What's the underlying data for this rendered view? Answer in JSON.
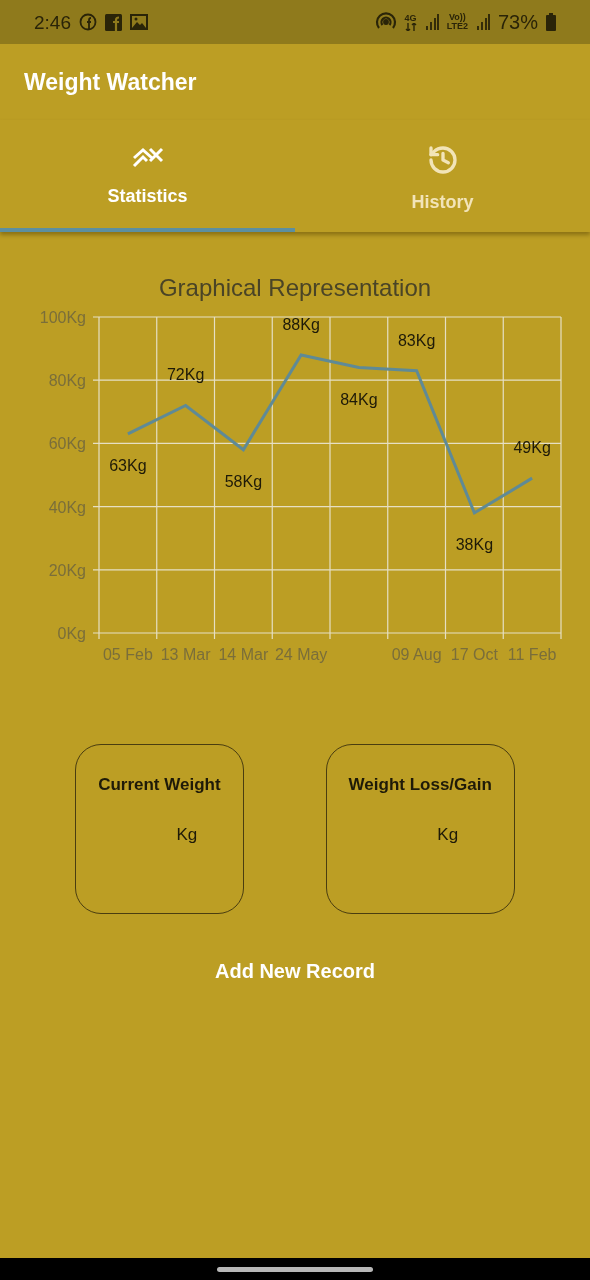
{
  "status_bar": {
    "time": "2:46",
    "network": "4G",
    "volte": "Vo))",
    "volte_sub": "LTE2",
    "battery": "73%"
  },
  "app_bar": {
    "title": "Weight Watcher"
  },
  "tabs": [
    {
      "label": "Statistics",
      "kind": "chart",
      "selected": true
    },
    {
      "label": "History",
      "kind": "history",
      "selected": false
    }
  ],
  "chart": {
    "chart_data": {
      "type": "line",
      "title": "Graphical Representation",
      "categories": [
        "05 Feb",
        "13 Mar",
        "14 Mar",
        "24 May",
        null,
        "09 Aug",
        "17 Oct",
        "11 Feb"
      ],
      "grid": true,
      "series": [
        {
          "color": "#5f8a96",
          "values": [
            63,
            72,
            58,
            88,
            84,
            83,
            38,
            49
          ]
        }
      ],
      "ylim": [
        0,
        100
      ],
      "yticks": [
        {
          "value": 0,
          "label": "0Kg"
        },
        {
          "value": 20,
          "label": "20Kg"
        },
        {
          "value": 40,
          "label": "40Kg"
        },
        {
          "value": 60,
          "label": "60Kg"
        },
        {
          "value": 80,
          "label": "80Kg"
        },
        {
          "value": 100,
          "label": "100Kg"
        }
      ],
      "value_labels": [
        "63Kg",
        "72Kg",
        "58Kg",
        "88Kg",
        "84Kg",
        "83Kg",
        "38Kg",
        "49Kg"
      ]
    }
  },
  "cards": [
    {
      "title": "Current Weight",
      "unit": "Kg"
    },
    {
      "title": "Weight Loss/Gain",
      "unit": "Kg"
    }
  ],
  "add_button": {
    "label": "Add New Record"
  }
}
